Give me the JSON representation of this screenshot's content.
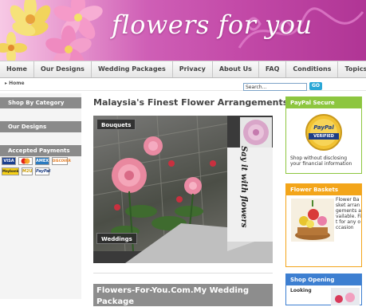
{
  "site": {
    "title": "flowers for you"
  },
  "nav": {
    "items": [
      "Home",
      "Our Designs",
      "Wedding Packages",
      "Privacy",
      "About Us",
      "FAQ",
      "Conditions",
      "Topics"
    ]
  },
  "breadcrumb": {
    "current": "Home"
  },
  "search": {
    "value": "Search...",
    "button_label": "GO"
  },
  "left_sidebar": {
    "shop_by_category": "Shop By Category",
    "our_designs": "Our Designs",
    "accepted_payments": "Accepted Payments",
    "payment_cards": [
      "VISA",
      "Master",
      "AMEX",
      "DISCOVER",
      "Maybank",
      "M2U",
      "PayPal"
    ]
  },
  "main": {
    "title": "Malaysia's Finest Flower Arrangements",
    "showcase": {
      "bouquets_label": "Bouquets",
      "weddings_label": "Weddings",
      "tagline": "Say it with flowers"
    },
    "wedding_section_title": "Flowers-For-You.Com.My Wedding Package"
  },
  "right_sidebar": {
    "paypal": {
      "heading": "PayPal Secure Shopping",
      "badge_line1": "PayPal",
      "badge_line2": "VERIFIED",
      "description": "Shop without disclosing your financial information"
    },
    "baskets": {
      "heading": "Flower Baskets",
      "description": "Flower Basket arrangements available. Fit for any occasion"
    },
    "opening": {
      "heading": "Shop Opening",
      "description": "Looking"
    }
  },
  "colors": {
    "brand_magenta": "#c34aa8",
    "nav_bg": "#ececec",
    "paypal_green": "#8dc63f",
    "basket_orange": "#f3a51a",
    "opening_blue": "#3d7fd1",
    "sidebar_gray": "#8a8a8a"
  }
}
